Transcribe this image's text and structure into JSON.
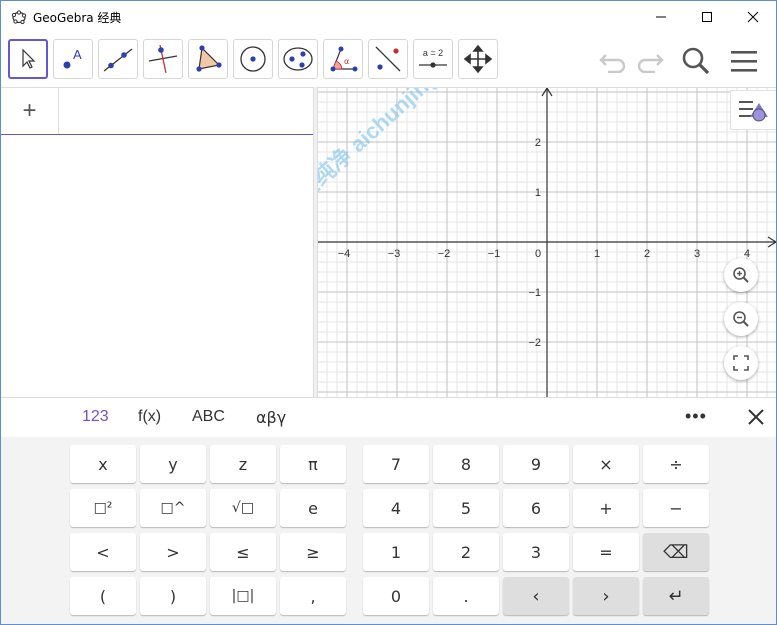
{
  "window": {
    "title": "GeoGebra 经典"
  },
  "toolbar": {
    "tools": [
      "move",
      "point",
      "line",
      "perpendicular-line",
      "polygon",
      "circle-center-point",
      "conic",
      "angle",
      "reflect",
      "slider",
      "move-graphics-view"
    ],
    "slider_label": "a = 2"
  },
  "algebra": {
    "add_symbol": "+"
  },
  "graphics": {
    "x_ticks": [
      "−4",
      "−3",
      "−2",
      "−1",
      "0",
      "1",
      "2",
      "3",
      "4"
    ],
    "y_ticks": [
      "2",
      "1",
      "−1",
      "−2"
    ],
    "x_range": [
      -4.6,
      4.6
    ],
    "y_range": [
      -3.1,
      3.1
    ],
    "grid": true,
    "watermark_text": "爱纯净 aichunjing.com"
  },
  "keyboard": {
    "tabs": [
      "123",
      "f(x)",
      "ABC",
      "αβγ"
    ],
    "active_tab": "123",
    "more": "•••",
    "left_keys": [
      [
        "x",
        "y",
        "z",
        "π"
      ],
      [
        "□²",
        "□^",
        "√□",
        "e"
      ],
      [
        "<",
        ">",
        "≤",
        "≥"
      ],
      [
        "(",
        ")",
        "|□|",
        ","
      ]
    ],
    "right_keys": [
      [
        "7",
        "8",
        "9",
        "×",
        "÷"
      ],
      [
        "4",
        "5",
        "6",
        "+",
        "−"
      ],
      [
        "1",
        "2",
        "3",
        "=",
        "⌫"
      ],
      [
        "0",
        ".",
        "‹",
        "›",
        "↵"
      ]
    ]
  },
  "colors": {
    "accent": "#6557d2",
    "axis": "#333333",
    "grid_major": "#c0c0c0",
    "grid_minor": "#e6e6e6"
  }
}
